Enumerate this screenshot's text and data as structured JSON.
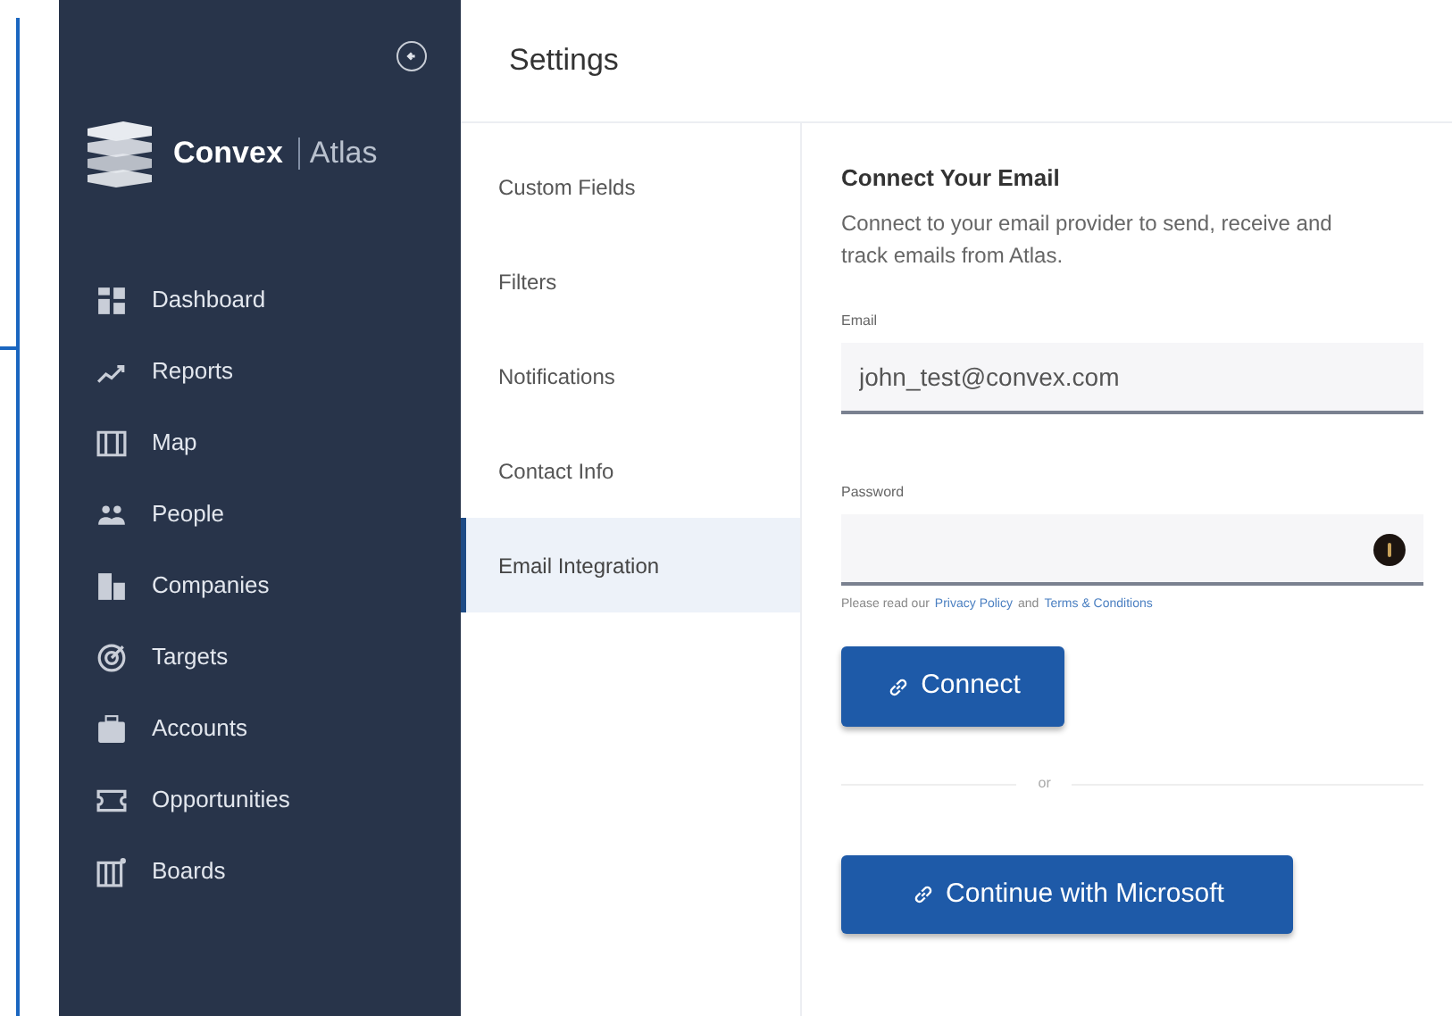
{
  "sidebar": {
    "brand": "Convex",
    "product": "Atlas",
    "items": [
      {
        "label": "Dashboard"
      },
      {
        "label": "Reports"
      },
      {
        "label": "Map"
      },
      {
        "label": "People"
      },
      {
        "label": "Companies"
      },
      {
        "label": "Targets"
      },
      {
        "label": "Accounts"
      },
      {
        "label": "Opportunities"
      },
      {
        "label": "Boards"
      }
    ]
  },
  "header": {
    "title": "Settings"
  },
  "settings_menu": [
    {
      "label": "Custom Fields",
      "selected": false
    },
    {
      "label": "Filters",
      "selected": false
    },
    {
      "label": "Notifications",
      "selected": false
    },
    {
      "label": "Contact Info",
      "selected": false
    },
    {
      "label": "Email Integration",
      "selected": true
    }
  ],
  "panel": {
    "title": "Connect Your Email",
    "description": "Connect to your email provider to send, receive and track emails from Atlas.",
    "fields": [
      {
        "label": "Email",
        "value": "john_test@convex.com",
        "kind": "text"
      },
      {
        "label": "Password",
        "kind": "password"
      }
    ],
    "legal": [
      {
        "kind": "text",
        "text": "Please read our"
      },
      {
        "kind": "link",
        "text": "Privacy Policy"
      },
      {
        "kind": "text",
        "text": "and"
      },
      {
        "kind": "link",
        "text": "Terms & Conditions"
      }
    ],
    "connect_button": "Connect",
    "divider": "or",
    "microsoft_button": "Continue with Microsoft"
  }
}
